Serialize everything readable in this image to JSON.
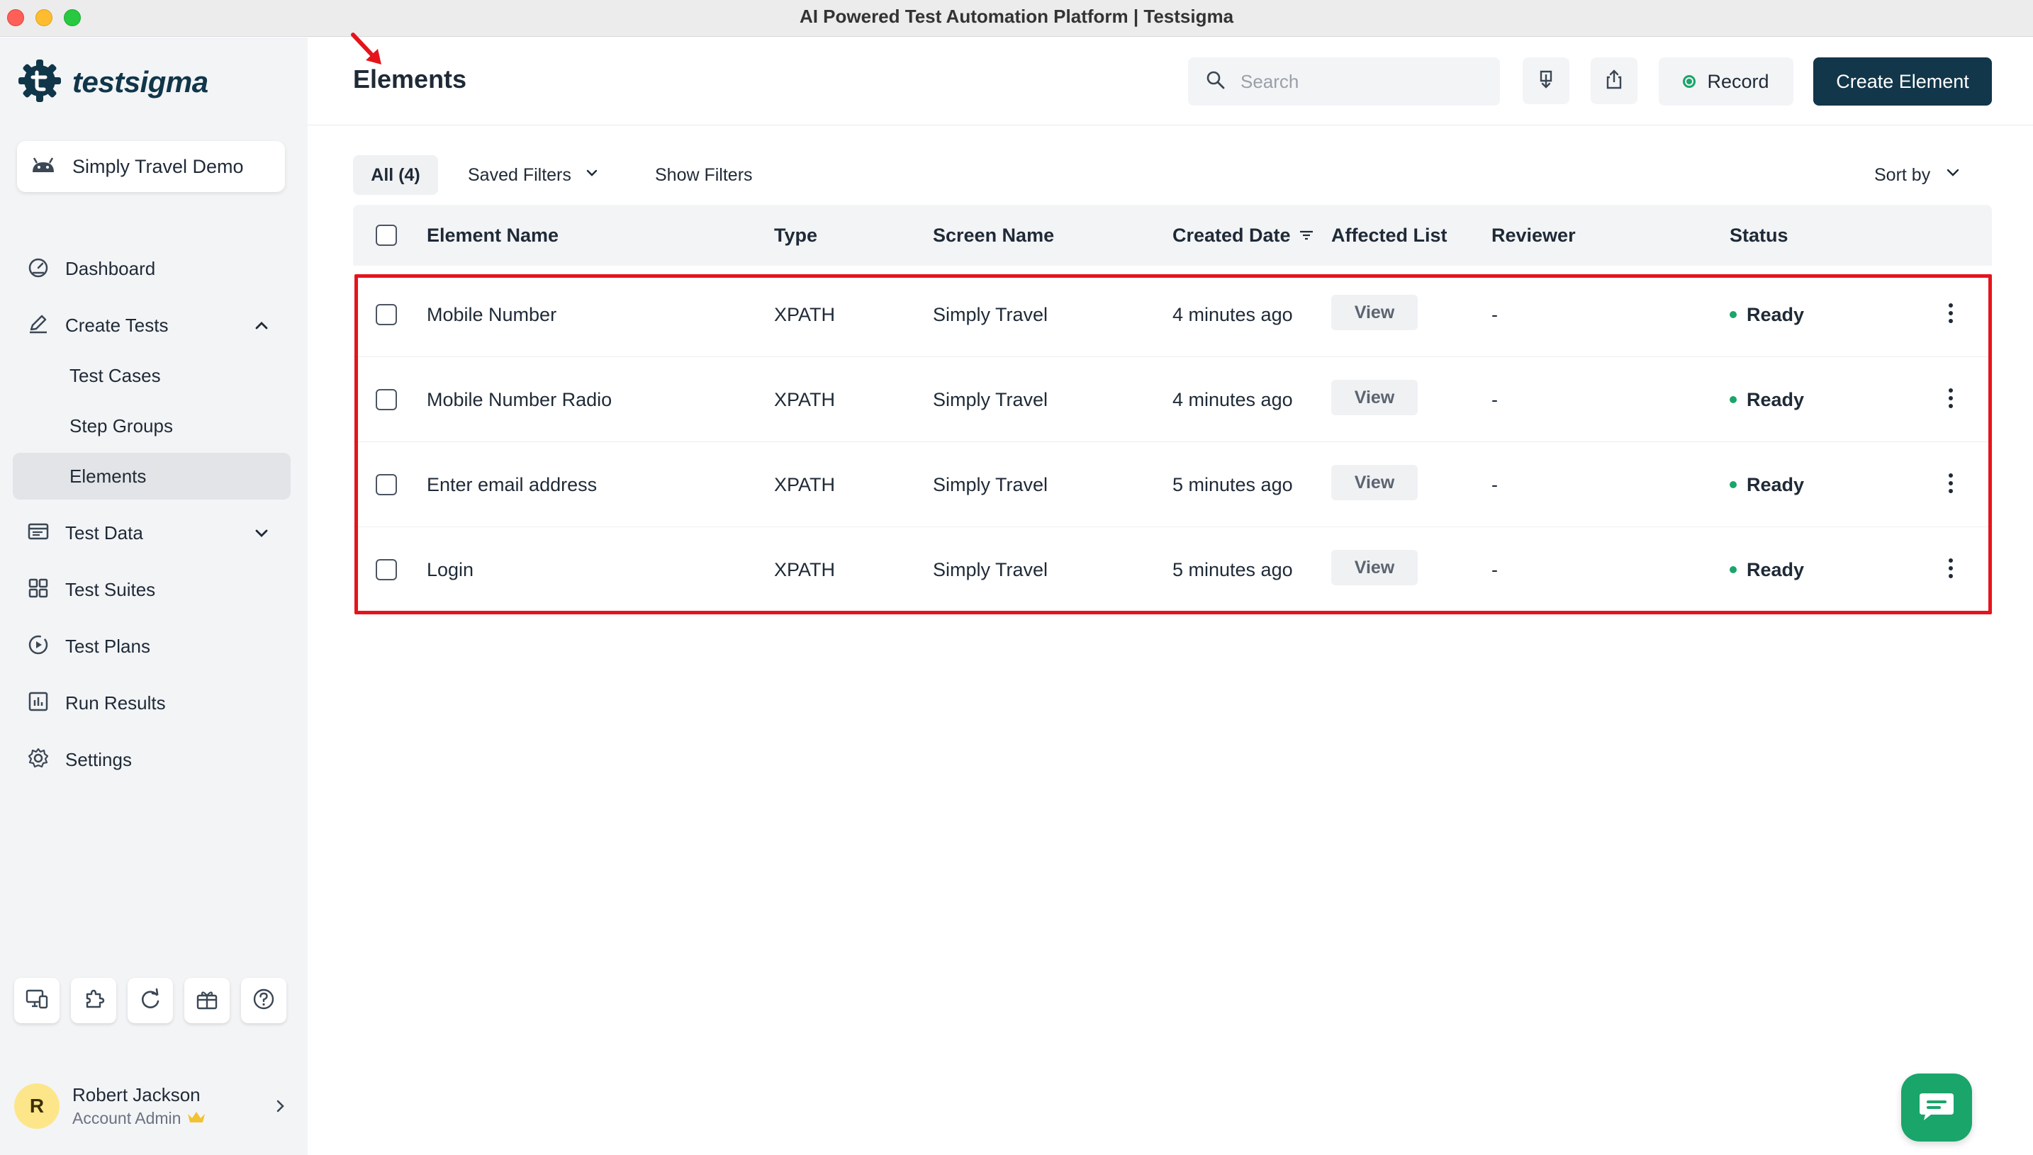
{
  "window": {
    "title": "AI Powered Test Automation Platform | Testsigma"
  },
  "brand": {
    "name": "testsigma"
  },
  "project": {
    "name": "Simply Travel Demo"
  },
  "sidebar": {
    "nav": [
      {
        "label": "Dashboard",
        "icon": "dashboard-icon"
      },
      {
        "label": "Create Tests",
        "icon": "pencil-icon",
        "expanded": true
      },
      {
        "label": "Test Data",
        "icon": "database-icon",
        "expanded": false
      },
      {
        "label": "Test Suites",
        "icon": "grid-icon"
      },
      {
        "label": "Test Plans",
        "icon": "play-circle-icon"
      },
      {
        "label": "Run Results",
        "icon": "bar-chart-icon"
      },
      {
        "label": "Settings",
        "icon": "gear-icon"
      }
    ],
    "sub": [
      {
        "label": "Test Cases"
      },
      {
        "label": "Step Groups"
      },
      {
        "label": "Elements",
        "active": true
      }
    ]
  },
  "tools": [
    "desktop-icon",
    "puzzle-icon",
    "refresh-icon",
    "gift-icon",
    "help-icon"
  ],
  "user": {
    "initial": "R",
    "name": "Robert Jackson",
    "role": "Account Admin"
  },
  "header": {
    "title": "Elements",
    "search_placeholder": "Search",
    "record_label": "Record",
    "create_label": "Create Element"
  },
  "filters": {
    "all_label": "All (4)",
    "saved_filters_label": "Saved Filters",
    "show_filters_label": "Show Filters",
    "sort_by_label": "Sort by"
  },
  "table": {
    "columns": {
      "name": "Element Name",
      "type": "Type",
      "screen": "Screen Name",
      "created": "Created Date",
      "affected": "Affected List",
      "reviewer": "Reviewer",
      "status": "Status"
    },
    "rows": [
      {
        "name": "Mobile Number",
        "type": "XPATH",
        "screen": "Simply Travel",
        "created": "4 minutes ago",
        "affected": "View",
        "reviewer": "-",
        "status": "Ready"
      },
      {
        "name": "Mobile Number Radio",
        "type": "XPATH",
        "screen": "Simply Travel",
        "created": "4 minutes ago",
        "affected": "View",
        "reviewer": "-",
        "status": "Ready"
      },
      {
        "name": "Enter email address",
        "type": "XPATH",
        "screen": "Simply Travel",
        "created": "5 minutes ago",
        "affected": "View",
        "reviewer": "-",
        "status": "Ready"
      },
      {
        "name": "Login",
        "type": "XPATH",
        "screen": "Simply Travel",
        "created": "5 minutes ago",
        "affected": "View",
        "reviewer": "-",
        "status": "Ready"
      }
    ]
  },
  "colors": {
    "brand": "#12364a",
    "status_ready": "#1aa56b",
    "annotation": "#e5141c"
  }
}
